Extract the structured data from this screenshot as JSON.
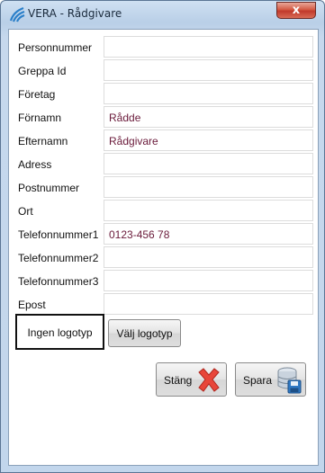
{
  "window": {
    "title": "VERA - Rådgivare",
    "close_label": "x"
  },
  "form": {
    "fields": [
      {
        "label": "Personnummer",
        "value": ""
      },
      {
        "label": "Greppa Id",
        "value": ""
      },
      {
        "label": "Företag",
        "value": ""
      },
      {
        "label": "Förnamn",
        "value": "Rådde"
      },
      {
        "label": "Efternamn",
        "value": "Rådgivare"
      },
      {
        "label": "Adress",
        "value": ""
      },
      {
        "label": "Postnummer",
        "value": ""
      },
      {
        "label": "Ort",
        "value": ""
      },
      {
        "label": "Telefonnummer1",
        "value": "0123-456 78"
      },
      {
        "label": "Telefonnummer2",
        "value": ""
      },
      {
        "label": "Telefonnummer3",
        "value": ""
      },
      {
        "label": "Epost",
        "value": ""
      }
    ]
  },
  "logo": {
    "status": "Ingen logotyp",
    "choose_label": "Välj logotyp"
  },
  "actions": {
    "close_label": "Stäng",
    "save_label": "Spara"
  },
  "icons": {
    "app": "vera-logo-icon",
    "close": "red-x-icon",
    "save": "database-save-icon"
  },
  "colors": {
    "value_text": "#6a1a3a",
    "close_button": "#c0392b"
  }
}
